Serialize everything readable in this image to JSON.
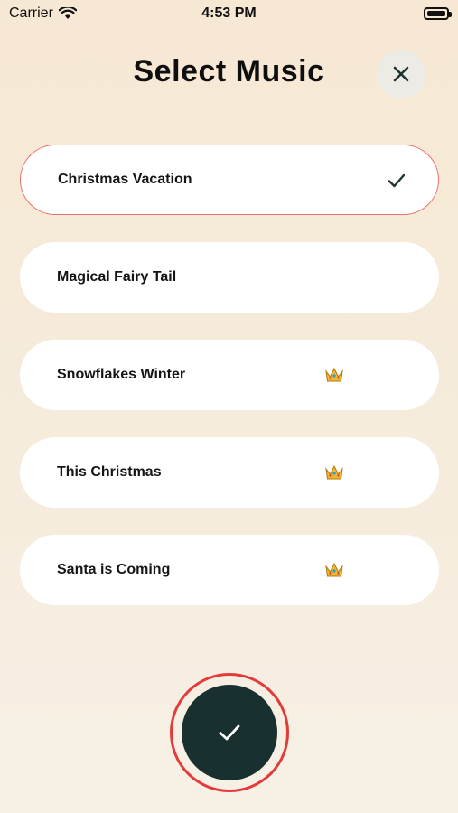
{
  "status_bar": {
    "carrier": "Carrier",
    "time": "4:53 PM"
  },
  "header": {
    "title": "Select Music"
  },
  "music_list": [
    {
      "label": "Christmas Vacation",
      "selected": true,
      "premium": false
    },
    {
      "label": "Magical Fairy Tail",
      "selected": false,
      "premium": false
    },
    {
      "label": "Snowflakes Winter",
      "selected": false,
      "premium": true
    },
    {
      "label": "This Christmas",
      "selected": false,
      "premium": true
    },
    {
      "label": "Santa is Coming",
      "selected": false,
      "premium": true
    }
  ],
  "icons": {
    "close": "close-icon",
    "selected": "checkmark-icon",
    "premium": "crown-icon",
    "confirm": "checkmark-icon"
  },
  "colors": {
    "accent_red": "#e33a3a",
    "selected_border": "#ea6f6a",
    "confirm_bg": "#18302f",
    "dark_green": "#1c3433"
  }
}
